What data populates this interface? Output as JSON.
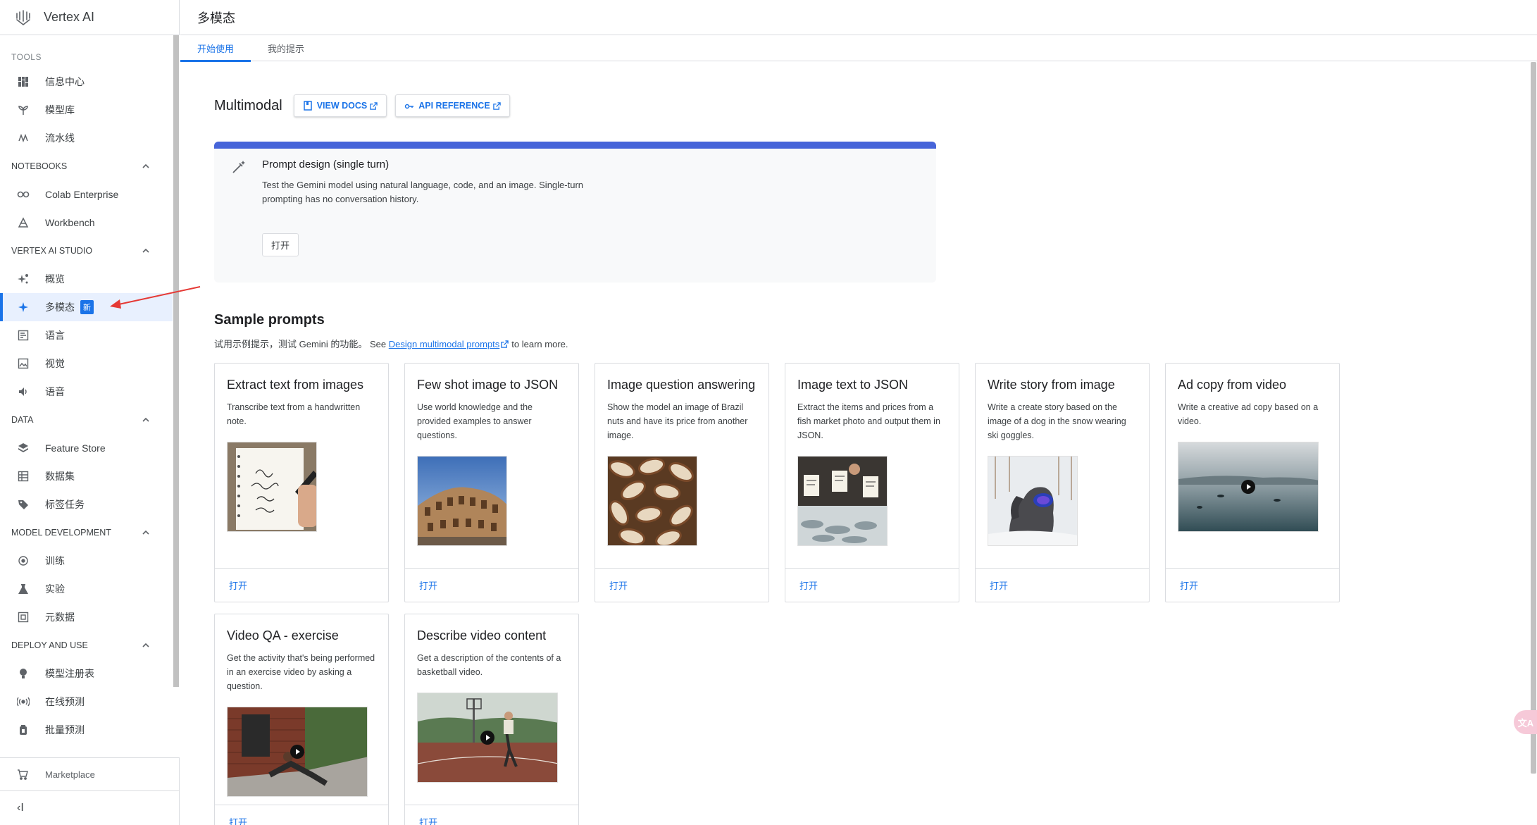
{
  "sidebar": {
    "brand": "Vertex AI",
    "tools_header": "TOOLS",
    "tools": [
      {
        "label": "信息中心",
        "icon": "dashboard-icon"
      },
      {
        "label": "模型库",
        "icon": "model-garden-icon"
      },
      {
        "label": "流水线",
        "icon": "pipelines-icon"
      }
    ],
    "sections": [
      {
        "header": "NOTEBOOKS",
        "items": [
          {
            "label": "Colab Enterprise",
            "icon": "colab-icon"
          },
          {
            "label": "Workbench",
            "icon": "workbench-icon"
          }
        ]
      },
      {
        "header": "VERTEX AI STUDIO",
        "items": [
          {
            "label": "概览",
            "icon": "overview-icon"
          },
          {
            "label": "多模态",
            "icon": "sparkle-icon",
            "badge": "新"
          },
          {
            "label": "语言",
            "icon": "language-icon"
          },
          {
            "label": "视觉",
            "icon": "vision-icon"
          },
          {
            "label": "语音",
            "icon": "speech-icon"
          }
        ]
      },
      {
        "header": "DATA",
        "items": [
          {
            "label": "Feature Store",
            "icon": "feature-store-icon"
          },
          {
            "label": "数据集",
            "icon": "datasets-icon"
          },
          {
            "label": "标签任务",
            "icon": "label-icon"
          }
        ]
      },
      {
        "header": "MODEL DEVELOPMENT",
        "items": [
          {
            "label": "训练",
            "icon": "training-icon"
          },
          {
            "label": "实验",
            "icon": "experiments-icon"
          },
          {
            "label": "元数据",
            "icon": "metadata-icon"
          }
        ]
      },
      {
        "header": "DEPLOY AND USE",
        "items": [
          {
            "label": "模型注册表",
            "icon": "model-registry-icon"
          },
          {
            "label": "在线预测",
            "icon": "online-prediction-icon"
          },
          {
            "label": "批量预测",
            "icon": "batch-prediction-icon"
          }
        ]
      }
    ],
    "marketplace": "Marketplace",
    "collapse_label": "‹I"
  },
  "header": {
    "title": "多模态"
  },
  "tabs": [
    {
      "label": "开始使用",
      "active": true
    },
    {
      "label": "我的提示",
      "active": false
    }
  ],
  "main": {
    "multimodal_title": "Multimodal",
    "view_docs": "VIEW DOCS",
    "api_reference": "API REFERENCE",
    "prompt_design": {
      "title": "Prompt design (single turn)",
      "description": "Test the Gemini model using natural language, code, and an image. Single-turn prompting has no conversation history.",
      "open": "打开"
    },
    "sample_prompts_title": "Sample prompts",
    "sample_sub_prefix": "试用示例提示，测试 Gemini 的功能。 See ",
    "sample_sub_link": "Design multimodal prompts",
    "sample_sub_suffix": "to learn more.",
    "cards": [
      {
        "title": "Extract text from images",
        "desc": "Transcribe text from a handwritten note.",
        "open": "打开"
      },
      {
        "title": "Few shot image to JSON",
        "desc": "Use world knowledge and the provided examples to answer questions.",
        "open": "打开"
      },
      {
        "title": "Image question answering",
        "desc": "Show the model an image of Brazil nuts and have its price from another image.",
        "open": "打开"
      },
      {
        "title": "Image text to JSON",
        "desc": "Extract the items and prices from a fish market photo and output them in JSON.",
        "open": "打开"
      },
      {
        "title": "Write story from image",
        "desc": "Write a create story based on the image of a dog in the snow wearing ski goggles.",
        "open": "打开"
      },
      {
        "title": "Ad copy from video",
        "desc": "Write a creative ad copy based on a video.",
        "open": "打开"
      },
      {
        "title": "Video QA - exercise",
        "desc": "Get the activity that's being performed in an exercise video by asking a question.",
        "open": "打开"
      },
      {
        "title": "Describe video content",
        "desc": "Get a description of the contents of a basketball video.",
        "open": "打开"
      }
    ]
  },
  "colors": {
    "accent": "#1a73e8",
    "banner": "#4765d9",
    "annotation_arrow": "#e53935"
  }
}
